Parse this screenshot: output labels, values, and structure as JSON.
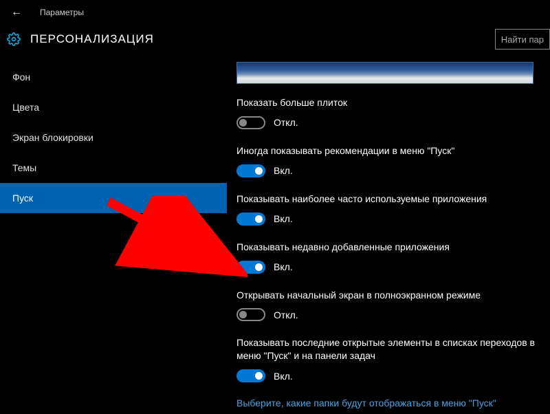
{
  "topbar": {
    "back_glyph": "←",
    "breadcrumb": "Параметры"
  },
  "header": {
    "title": "ПЕРСОНАЛИЗАЦИЯ",
    "search_placeholder": "Найти пар"
  },
  "sidebar": {
    "items": [
      {
        "label": "Фон"
      },
      {
        "label": "Цвета"
      },
      {
        "label": "Экран блокировки"
      },
      {
        "label": "Темы"
      },
      {
        "label": "Пуск"
      }
    ],
    "selected_index": 4
  },
  "settings": [
    {
      "label": "Показать больше плиток",
      "on": false
    },
    {
      "label": "Иногда показывать рекомендации в меню \"Пуск\"",
      "on": true
    },
    {
      "label": "Показывать наиболее часто используемые приложения",
      "on": true
    },
    {
      "label": "Показывать недавно добавленные приложения",
      "on": true
    },
    {
      "label": "Открывать начальный экран в полноэкранном режиме",
      "on": false
    },
    {
      "label": "Показывать последние открытые элементы в списках переходов в меню \"Пуск\" и на панели задач",
      "on": true
    }
  ],
  "toggle_states": {
    "on": "Вкл.",
    "off": "Откл."
  },
  "footer_link": "Выберите, какие папки будут отображаться в меню \"Пуск\"",
  "colors": {
    "accent": "#0078d4",
    "selection": "#0063b1",
    "link": "#4aa3df",
    "arrow": "#ff0000"
  }
}
